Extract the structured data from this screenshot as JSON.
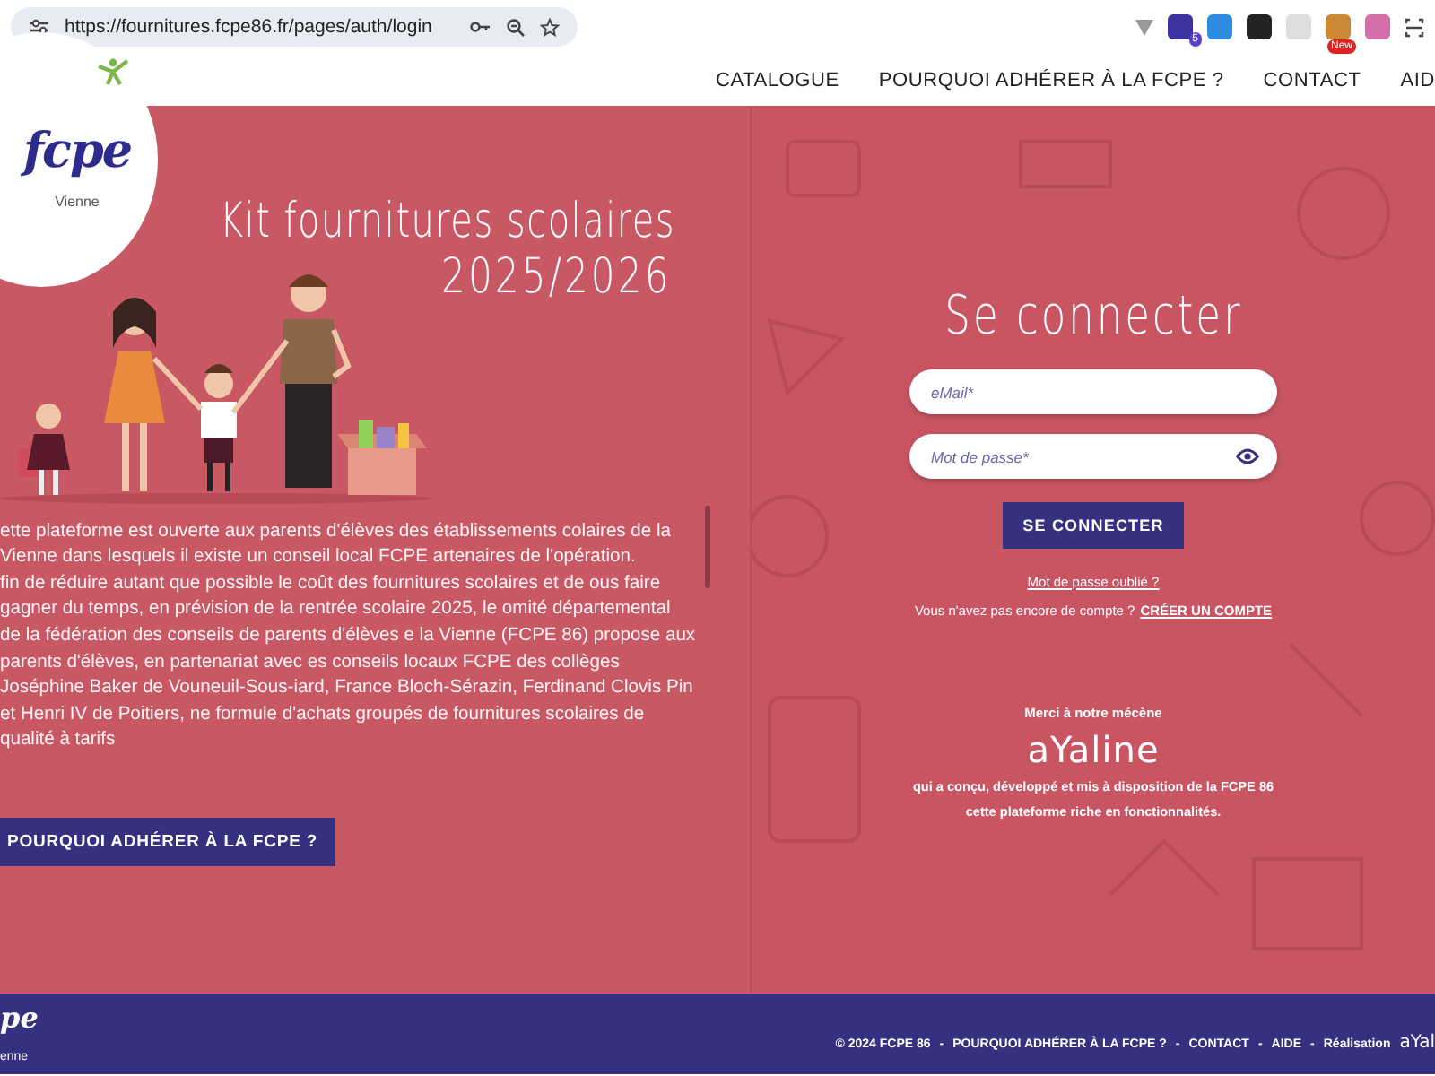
{
  "browser": {
    "url": "https://fournitures.fcpe86.fr/pages/auth/login",
    "extension_badges": [
      "5",
      "New"
    ]
  },
  "header": {
    "logo": {
      "text": "fcpe",
      "region": "Vienne"
    },
    "nav": [
      {
        "label": "CATALOGUE"
      },
      {
        "label": "POURQUOI ADHÉRER À LA FCPE ?"
      },
      {
        "label": "CONTACT"
      },
      {
        "label": "AID"
      }
    ]
  },
  "intro": {
    "title": "Kit fournitures scolaires",
    "year": "2025/2026",
    "paragraphs": [
      "ette plateforme est ouverte aux parents d'élèves des établissements colaires de la Vienne dans lesquels il existe un conseil local FCPE artenaires de l'opération.",
      "fin de réduire autant que possible le coût des fournitures scolaires et de ous faire gagner du temps, en prévision de la rentrée scolaire 2025, le omité départemental de la fédération des conseils de parents d'élèves e la Vienne (FCPE 86) propose aux parents d'élèves, en partenariat avec es conseils locaux FCPE des collèges Joséphine Baker de Vouneuil-Sous-iard, France Bloch-Sérazin, Ferdinand Clovis Pin et Henri IV de Poitiers, ne formule d'achats groupés de fournitures scolaires de qualité à tarifs"
    ],
    "button": "POURQUOI ADHÉRER À LA FCPE ?"
  },
  "login": {
    "title": "Se connecter",
    "fields": [
      {
        "kind": "text",
        "placeholder": "eMail*"
      },
      {
        "kind": "password",
        "placeholder": "Mot de passe*"
      }
    ],
    "submit": "SE CONNECTER",
    "forgot": "Mot de passe oublié ?",
    "signup_prompt": "Vous n'avez pas encore de compte ?",
    "signup_link": "CRÉER UN COMPTE",
    "sponsor": {
      "thanks": "Merci à notre mécène",
      "name": "aYaline",
      "description": "qui a conçu, développé et mis à disposition de la FCPE 86 cette plateforme riche en fonctionnalités."
    }
  },
  "footer": {
    "logo": {
      "text": "pe",
      "region": "enne"
    },
    "links": [
      "© 2024 FCPE 86",
      "POURQUOI ADHÉRER À LA FCPE ?",
      "CONTACT",
      "AIDE"
    ],
    "separator": "-",
    "credit": "Réalisation",
    "credit_brand": "aYal"
  }
}
